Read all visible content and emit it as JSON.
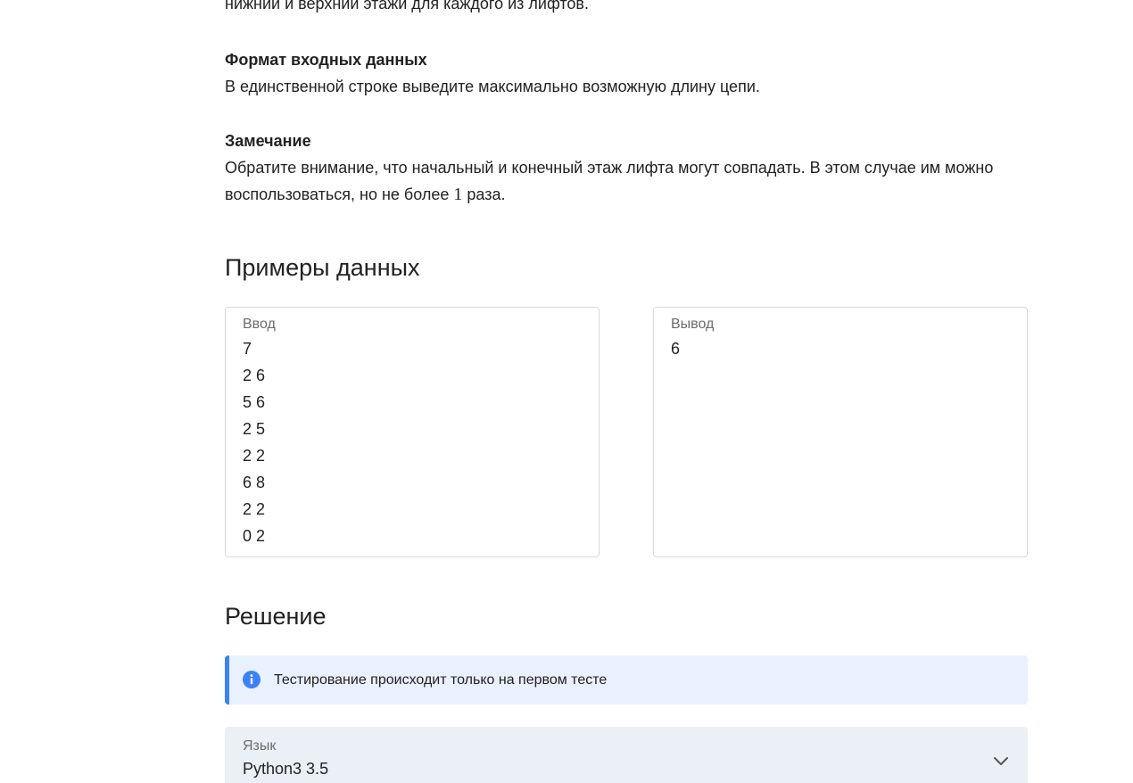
{
  "statement": {
    "cut_line": "нижний и верхний этажи для каждого из лифтов.",
    "output_heading": "Формат входных данных",
    "output_text": "В единственной строке выведите максимально возможную длину цепи.",
    "note_heading": "Замечание",
    "note_text_1": "Обратите внимание, что начальный и конечный этаж лифта могут совпадать. В этом случае им можно",
    "note_text_2_pre": "воспользоваться, но не более ",
    "note_text_2_num": "1",
    "note_text_2_post": " раза."
  },
  "examples": {
    "title": "Примеры данных",
    "input_label": "Ввод",
    "input_lines": [
      "7",
      "2 6",
      "5 6",
      "2 5",
      "2 2",
      "6 8",
      "2 2",
      "0 2"
    ],
    "output_label": "Вывод",
    "output_lines": [
      "6"
    ]
  },
  "solution": {
    "title": "Решение",
    "info_text": "Тестирование происходит только на первом тесте",
    "info_icon": "info-icon",
    "language_label": "Язык",
    "language_value": "Python3 3.5",
    "dropdown_icon": "chevron-down-icon"
  },
  "colors": {
    "accent": "#3b82f6",
    "info_background": "#e8f1fd",
    "select_background": "#ebf0f7"
  }
}
